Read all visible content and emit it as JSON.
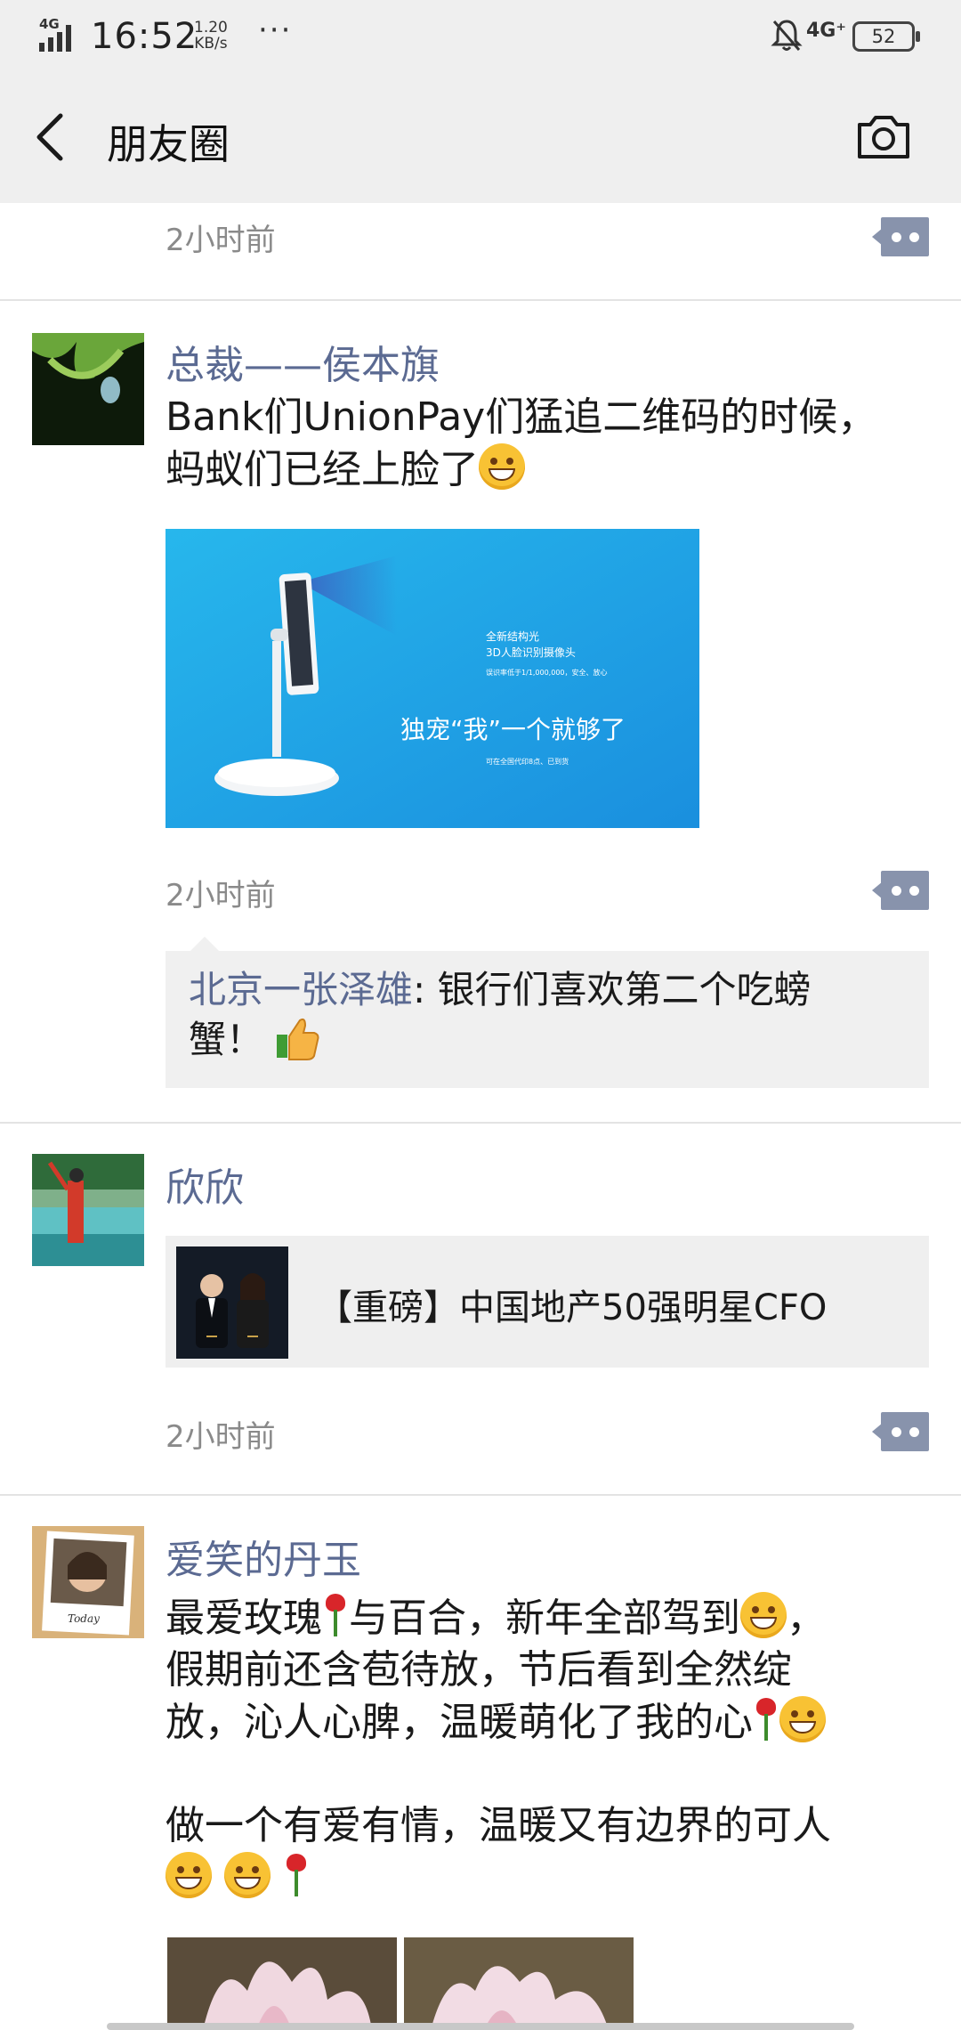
{
  "status_bar": {
    "network_left": "4G",
    "time": "16:52",
    "speed_value": "1.20",
    "speed_unit": "KB/s",
    "more": "···",
    "network_right": "4G⁺",
    "battery": "52"
  },
  "header": {
    "title": "朋友圈"
  },
  "posts": [
    {
      "time": "2小时前"
    },
    {
      "author": "总裁——侯本旗",
      "text_line1": "Bank们UnionPay们猛追二维码的时候，",
      "text_line2": "蚂蚁们已经上脸了",
      "image": {
        "small1": "全新结构光",
        "small2": "3D人脸识别摄像头",
        "small3": "误识率低于1/1,000,000，安全、放心",
        "headline": "独宠“我”一个就够了",
        "small4": "可在全国代印8点、已到货"
      },
      "time": "2小时前",
      "comment": {
        "author": "北京一张泽雄",
        "text_line1": ": 银行们喜欢第二个吃螃",
        "text_line2": "蟹！"
      }
    },
    {
      "author": "欣欣",
      "link_title": "【重磅】中国地产50强明星CFO",
      "time": "2小时前"
    },
    {
      "author": "爱笑的丹玉",
      "line1_a": "最爱玫瑰",
      "line1_b": "与百合，新年全部驾到",
      "line1_c": "，",
      "line2": "假期前还含苞待放，节后看到全然绽",
      "line3": "放，沁人心脾，温暖萌化了我的心",
      "line4": "做一个有爱有情，温暖又有边界的可人"
    }
  ],
  "colors": {
    "name_blue": "#5b6a92",
    "more_button": "#8893ac",
    "header_bg": "#efefef"
  }
}
